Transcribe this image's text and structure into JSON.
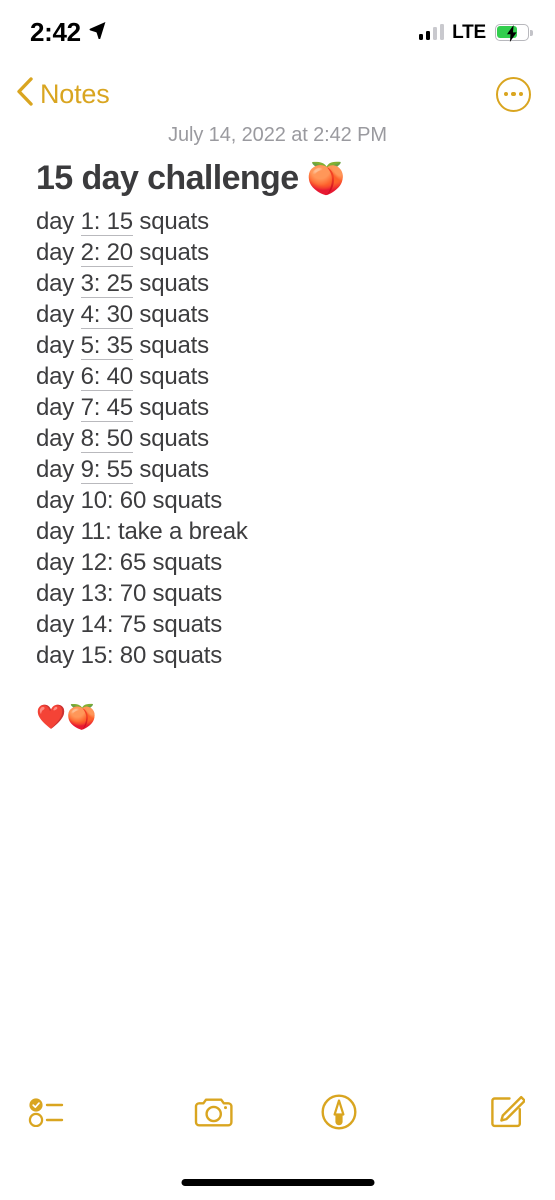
{
  "status_bar": {
    "time": "2:42",
    "location_icon": "location-arrow-icon",
    "signal_icon": "cellular-signal-icon",
    "signal_bars_filled": 2,
    "signal_bars_total": 4,
    "carrier_network": "LTE",
    "battery_icon": "battery-charging-icon",
    "battery_charging": true,
    "battery_color": "#32CE4E"
  },
  "nav_bar": {
    "back_icon": "chevron-left-icon",
    "back_label": "Notes",
    "more_icon": "more-circle-icon",
    "accent_color": "#D9A520"
  },
  "note": {
    "date": "July 14, 2022 at 2:42 PM",
    "title": "15 day challenge",
    "title_emoji": "🍑",
    "lines": [
      {
        "prefix": "day ",
        "detected": "1: 15",
        "suffix": " squats"
      },
      {
        "prefix": "day ",
        "detected": "2: 20",
        "suffix": " squats"
      },
      {
        "prefix": "day ",
        "detected": "3: 25",
        "suffix": " squats"
      },
      {
        "prefix": "day ",
        "detected": "4: 30",
        "suffix": " squats"
      },
      {
        "prefix": "day ",
        "detected": "5: 35",
        "suffix": " squats"
      },
      {
        "prefix": "day ",
        "detected": "6: 40",
        "suffix": " squats"
      },
      {
        "prefix": "day ",
        "detected": "7: 45",
        "suffix": " squats"
      },
      {
        "prefix": "day ",
        "detected": "8: 50",
        "suffix": " squats"
      },
      {
        "prefix": "day ",
        "detected": "9: 55",
        "suffix": " squats"
      },
      {
        "prefix": "day 10: 60 squats",
        "detected": "",
        "suffix": ""
      },
      {
        "prefix": "day 11: take a break",
        "detected": "",
        "suffix": ""
      },
      {
        "prefix": "day 12: 65 squats",
        "detected": "",
        "suffix": ""
      },
      {
        "prefix": "day 13: 70 squats",
        "detected": "",
        "suffix": ""
      },
      {
        "prefix": "day 14: 75 squats",
        "detected": "",
        "suffix": ""
      },
      {
        "prefix": "day 15: 80 squats",
        "detected": "",
        "suffix": ""
      }
    ],
    "footer_emoji": "❤️🍑"
  },
  "toolbar": {
    "items": [
      {
        "name": "checklist-icon",
        "label": "Checklist"
      },
      {
        "name": "camera-icon",
        "label": "Camera"
      },
      {
        "name": "markup-pen-icon",
        "label": "Markup"
      },
      {
        "name": "compose-icon",
        "label": "New Note"
      }
    ]
  }
}
